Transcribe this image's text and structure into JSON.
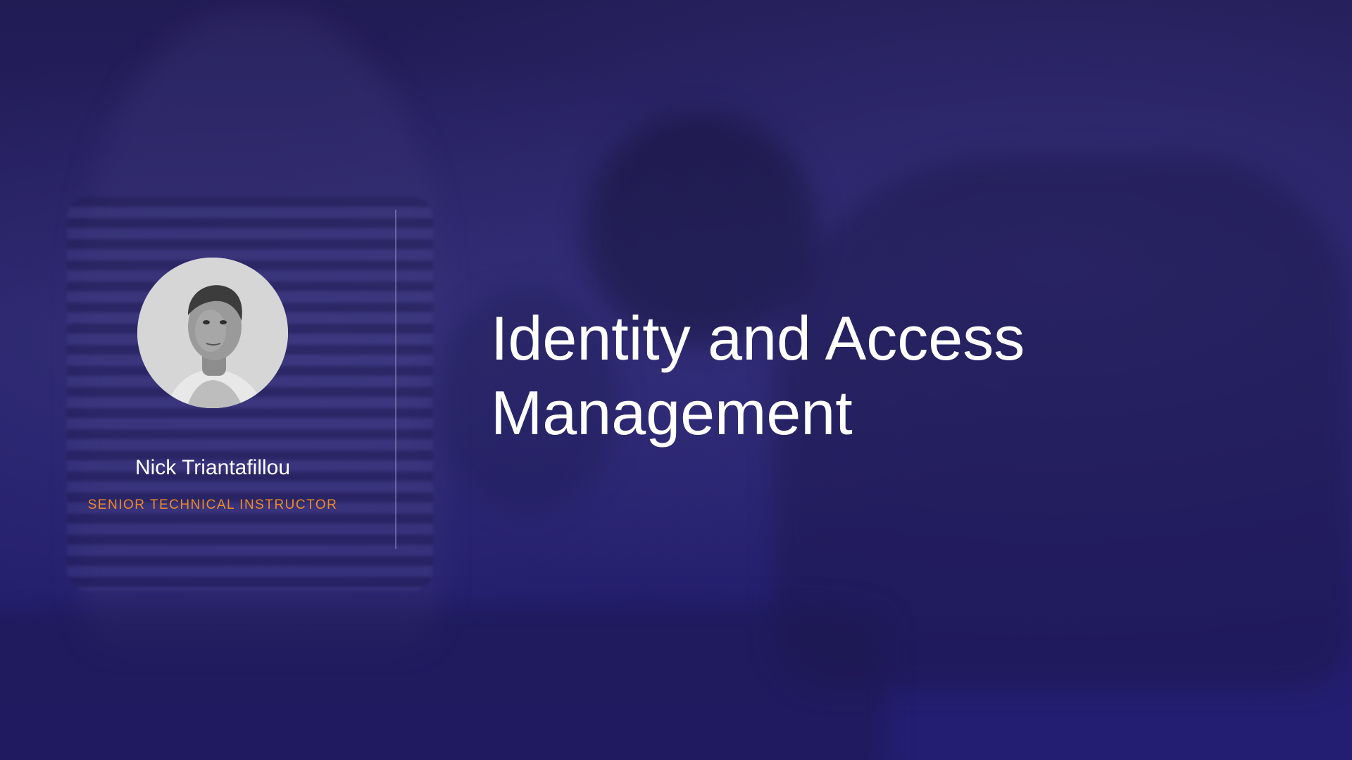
{
  "presenter": {
    "name": "Nick Triantafillou",
    "role": "SENIOR TECHNICAL INSTRUCTOR"
  },
  "title": {
    "line1": "Identity and Access",
    "line2": "Management"
  },
  "colors": {
    "background": "#241f66",
    "title_text": "#ffffff",
    "role_text": "#f08a24",
    "divider": "#aaa5d2"
  }
}
